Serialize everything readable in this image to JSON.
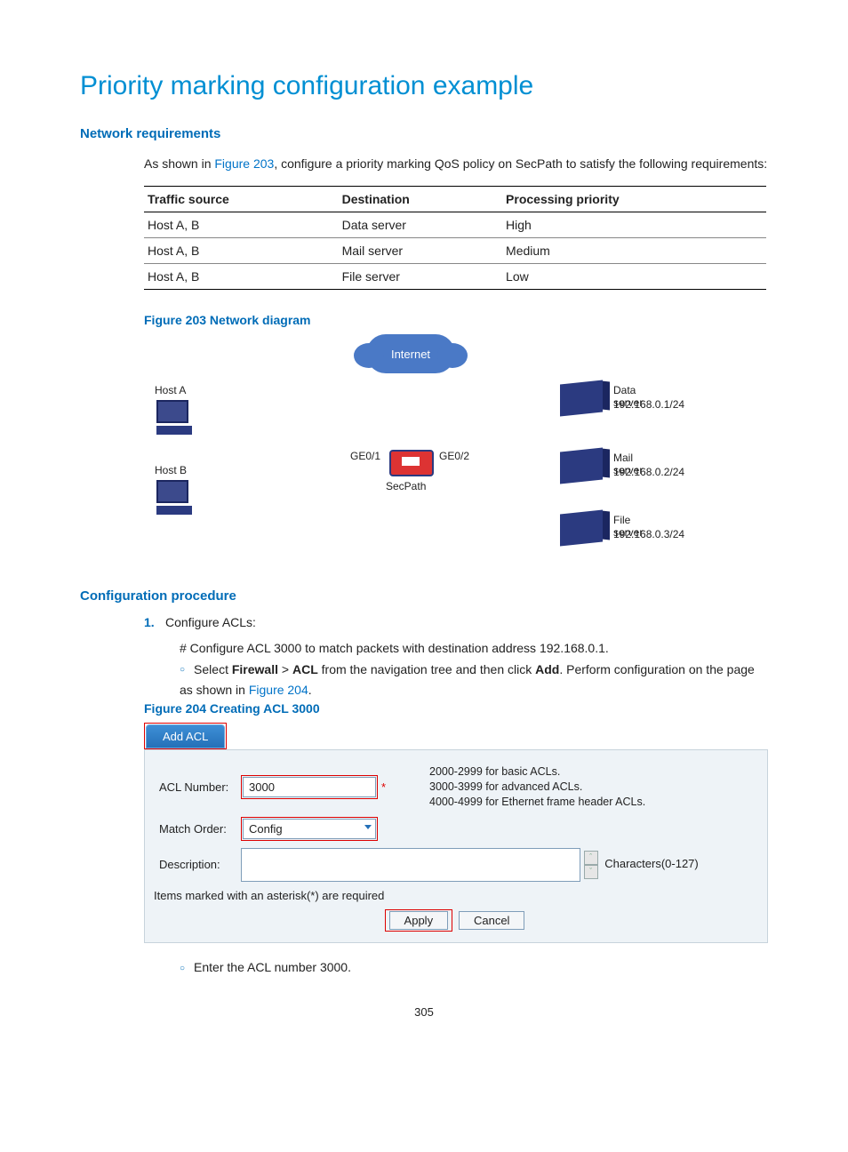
{
  "title": "Priority marking configuration example",
  "section1": {
    "heading": "Network requirements",
    "intro_pre": "As shown in ",
    "intro_link": "Figure 203",
    "intro_post": ", configure a priority marking QoS policy on SecPath to satisfy the following requirements:"
  },
  "table": {
    "headers": [
      "Traffic source",
      "Destination",
      "Processing priority"
    ],
    "rows": [
      [
        "Host A, B",
        "Data server",
        "High"
      ],
      [
        "Host A, B",
        "Mail server",
        "Medium"
      ],
      [
        "Host A, B",
        "File server",
        "Low"
      ]
    ]
  },
  "figure203": {
    "caption": "Figure 203 Network diagram",
    "internet": "Internet",
    "hostA": "Host A",
    "hostB": "Host B",
    "ge01": "GE0/1",
    "ge02": "GE0/2",
    "secpath": "SecPath",
    "servers": [
      {
        "name": "Data server",
        "ip": "192.168.0.1/24"
      },
      {
        "name": "Mail server",
        "ip": "192.168.0.2/24"
      },
      {
        "name": "File server",
        "ip": "192.168.0.3/24"
      }
    ]
  },
  "section2": {
    "heading": "Configuration procedure",
    "step1": "Configure ACLs:",
    "step1_detail": "# Configure ACL 3000 to match packets with destination address 192.168.0.1.",
    "bullet1_pre": "Select ",
    "bullet1_b1": "Firewall",
    "bullet1_mid": " > ",
    "bullet1_b2": "ACL",
    "bullet1_post1": " from the navigation tree and then click ",
    "bullet1_b3": "Add",
    "bullet1_post2": ". Perform configuration on the page as shown in ",
    "bullet1_link": "Figure 204",
    "bullet1_end": "."
  },
  "figure204": {
    "caption": "Figure 204 Creating ACL 3000",
    "tab": "Add ACL",
    "acl_label": "ACL Number:",
    "acl_value": "3000",
    "acl_help": "2000-2999 for basic ACLs.\n3000-3999 for advanced ACLs.\n4000-4999 for Ethernet frame header ACLs.",
    "match_label": "Match Order:",
    "match_value": "Config",
    "desc_label": "Description:",
    "chars": "Characters(0-127)",
    "note": "Items marked with an asterisk(*) are required",
    "apply": "Apply",
    "cancel": "Cancel"
  },
  "bullet2": "Enter the ACL number 3000.",
  "page_number": "305"
}
